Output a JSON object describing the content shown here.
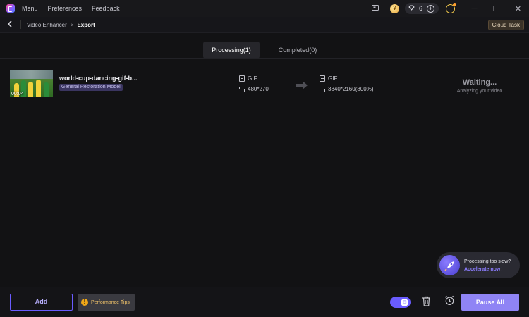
{
  "titlebar": {
    "menu_items": [
      "Menu",
      "Preferences",
      "Feedback"
    ],
    "credits_count": "6",
    "icons": {
      "app_logo": "app-logo",
      "screen": "screen-icon",
      "coin": "coin-icon",
      "diamond": "diamond-icon",
      "plus": "plus-icon",
      "avatar": "avatar-icon"
    },
    "window_controls": [
      "─",
      "☐",
      "✕"
    ]
  },
  "breadcrumb": {
    "items": [
      "Video Enhancer",
      "Export"
    ],
    "separator": ">"
  },
  "cloud_task_label": "Cloud Task",
  "tabs": [
    {
      "label": "Processing(1)",
      "active": true
    },
    {
      "label": "Completed(0)",
      "active": false
    }
  ],
  "task": {
    "file_name": "world-cup-dancing-gif-b...",
    "duration": "00:04",
    "model": "General Restoration Model",
    "source": {
      "format": "GIF",
      "resolution": "480*270"
    },
    "target": {
      "format": "GIF",
      "resolution": "3840*2160(800%)"
    },
    "status": "Waiting...",
    "status_detail": "Analyzing your video"
  },
  "accelerate": {
    "question": "Processing too slow?",
    "link": "Accelerate now!"
  },
  "bottom": {
    "add_label": "Add",
    "tips_label": "Performance Tips",
    "pause_all_label": "Pause All"
  },
  "colors": {
    "accent": "#6a5cff",
    "pause_button": "#8f84f5",
    "warning": "#f0a818",
    "background": "#121214"
  }
}
